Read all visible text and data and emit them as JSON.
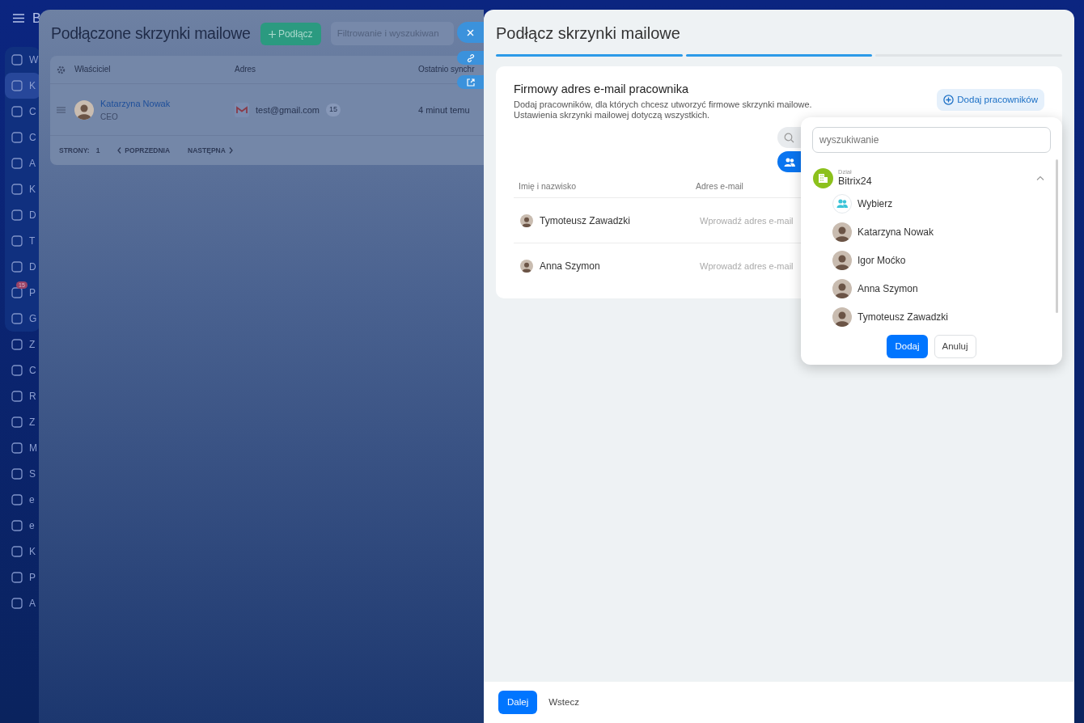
{
  "top_bar": {
    "logo_letter": "B"
  },
  "sidebar": {
    "groups": [
      {
        "kind": "pinned",
        "items": [
          {
            "letter": "W",
            "selected": false
          },
          {
            "letter": "K",
            "selected": true
          },
          {
            "letter": "C",
            "selected": false
          },
          {
            "letter": "C",
            "selected": false
          },
          {
            "letter": "A",
            "selected": false
          },
          {
            "letter": "K",
            "selected": false
          },
          {
            "letter": "D",
            "selected": false
          },
          {
            "letter": "T",
            "selected": false
          },
          {
            "letter": "D",
            "selected": false
          },
          {
            "letter": "P",
            "selected": false,
            "badge": "15"
          },
          {
            "letter": "G",
            "selected": false
          }
        ]
      },
      {
        "kind": "plain",
        "items": [
          {
            "letter": "Z",
            "selected": false
          },
          {
            "letter": "C",
            "selected": false
          },
          {
            "letter": "R",
            "selected": false
          },
          {
            "letter": "Z",
            "selected": false
          },
          {
            "letter": "M",
            "selected": false
          },
          {
            "letter": "S",
            "selected": false
          },
          {
            "letter": "e",
            "selected": false
          },
          {
            "letter": "e",
            "selected": false
          },
          {
            "letter": "K",
            "selected": false
          },
          {
            "letter": "P",
            "selected": false
          },
          {
            "letter": "A",
            "selected": false
          }
        ]
      }
    ]
  },
  "back_panel": {
    "title": "Podłączone skrzynki mailowe",
    "connect_button": "Podłącz",
    "filter_placeholder": "Filtrowanie i wyszukiwan",
    "table": {
      "columns": [
        "Właściciel",
        "Adres",
        "Ostatnio synchr"
      ],
      "rows": [
        {
          "owner": "Katarzyna Nowak",
          "position": "CEO",
          "address": "test@gmail.com",
          "count": "15",
          "last_sync": "4 minut temu"
        }
      ]
    },
    "pager": {
      "label": "STRONY:",
      "page": "1",
      "previous": "POPRZEDNIA",
      "next": "NASTĘPNA"
    }
  },
  "panel": {
    "title": "Podłącz skrzynki mailowe",
    "steps": [
      {
        "done": true
      },
      {
        "done": true
      },
      {
        "done": false
      }
    ],
    "card": {
      "title": "Firmowy adres e-mail pracownika",
      "description": [
        "Dodaj pracowników, dla których chcesz utworzyć firmowe skrzynki mailowe.",
        "Ustawienia skrzynki mailowej dotyczą wszystkich."
      ],
      "add_button": "Dodaj pracowników",
      "columns": [
        "Imię i nazwisko",
        "Adres e-mail"
      ],
      "rows": [
        {
          "name": "Tymoteusz Zawadzki",
          "email_placeholder": "Wprowadź adres e-mail"
        },
        {
          "name": "Anna Szymon",
          "email_placeholder": "Wprowadź adres e-mail"
        }
      ]
    },
    "picker": {
      "search_placeholder": "wyszukiwanie",
      "department": {
        "caption": "Dział",
        "name": "Bitrix24",
        "expanded": true
      },
      "items": [
        {
          "kind": "group",
          "label": "Wybierz"
        },
        {
          "kind": "person",
          "label": "Katarzyna Nowak"
        },
        {
          "kind": "person",
          "label": "Igor Moćko"
        },
        {
          "kind": "person",
          "label": "Anna Szymon"
        },
        {
          "kind": "person",
          "label": "Tymoteusz Zawadzki"
        }
      ],
      "add_button": "Dodaj",
      "cancel_button": "Anuluj"
    },
    "footer": {
      "next_button": "Dalej",
      "back_button": "Wstecz"
    }
  }
}
